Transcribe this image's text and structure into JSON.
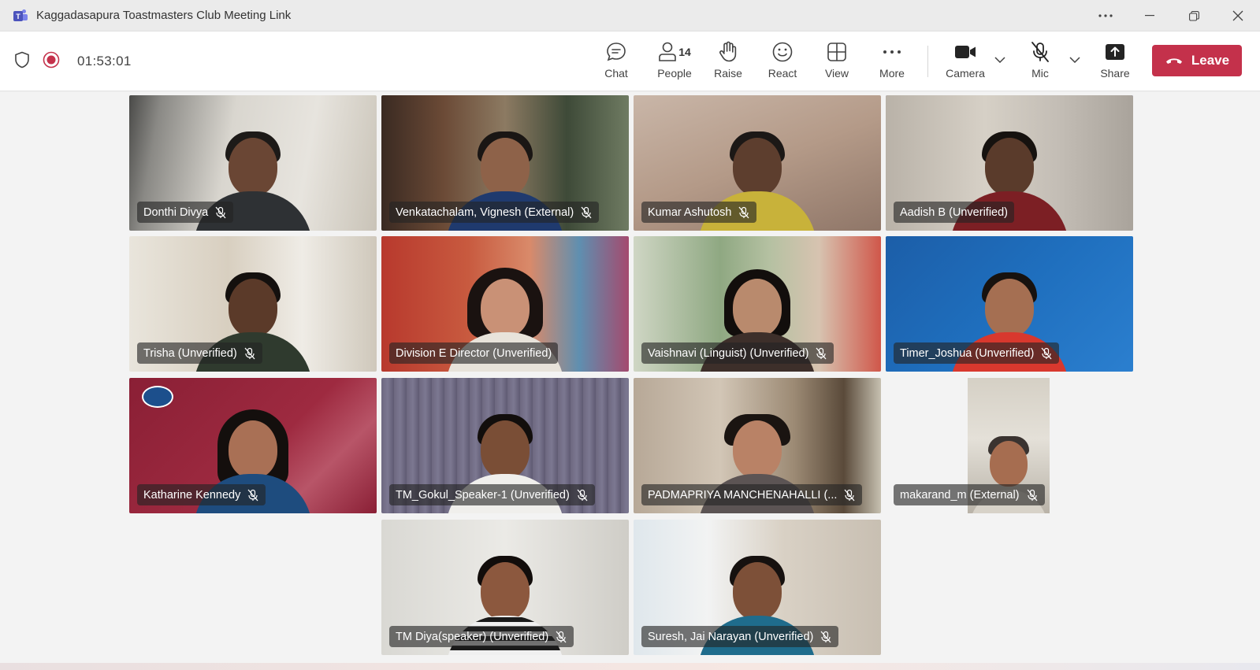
{
  "window": {
    "title": "Kaggadasapura Toastmasters Club Meeting Link"
  },
  "toolbar": {
    "elapsed": "01:53:01",
    "chat_label": "Chat",
    "people_label": "People",
    "people_count": "14",
    "raise_label": "Raise",
    "react_label": "React",
    "view_label": "View",
    "more_label": "More",
    "camera_label": "Camera",
    "mic_label": "Mic",
    "share_label": "Share",
    "leave_label": "Leave"
  },
  "colors": {
    "accent": "#7f85f5",
    "leave": "#c4314b",
    "recording": "#c4314b"
  },
  "participants": [
    {
      "name": "Donthi Divya"
    },
    {
      "name": "Venkatachalam, Vignesh (External)"
    },
    {
      "name": "Kumar Ashutosh"
    },
    {
      "name": "Aadish B (Unverified)"
    },
    {
      "name": "Trisha (Unverified)"
    },
    {
      "name": "Division E Director (Unverified)"
    },
    {
      "name": "Vaishnavi (Linguist) (Unverified)"
    },
    {
      "name": "Timer_Joshua (Unverified)"
    },
    {
      "name": "Katharine Kennedy"
    },
    {
      "name": "TM_Gokul_Speaker-1 (Unverified)"
    },
    {
      "name": "PADMAPRIYA MANCHENAHALLI (..."
    },
    {
      "name": "makarand_m (External)"
    },
    {
      "name": "TM Diya(speaker) (Unverified)"
    },
    {
      "name": "Suresh, Jai Narayan (Unverified)"
    }
  ]
}
